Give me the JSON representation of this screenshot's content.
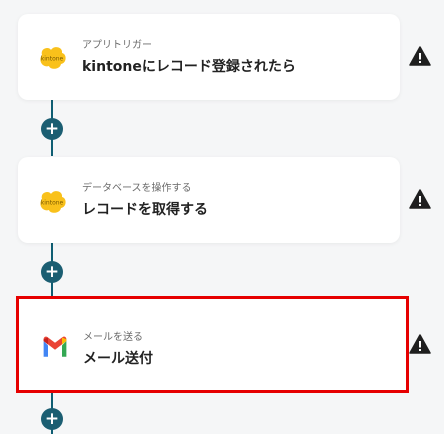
{
  "steps": [
    {
      "subtitle": "アプリトリガー",
      "title": "kintoneにレコード登録されたら",
      "app": "kintone",
      "icon": "kintone-icon"
    },
    {
      "subtitle": "データベースを操作する",
      "title": "レコードを取得する",
      "app": "kintone",
      "icon": "kintone-icon"
    },
    {
      "subtitle": "メールを送る",
      "title": "メール送付",
      "app": "Gmail",
      "icon": "gmail-icon",
      "selected": true
    }
  ],
  "add_button_label": "+",
  "icons": {
    "warning": "warning-icon",
    "add": "plus-icon"
  },
  "colors": {
    "connector": "#0f5e73",
    "add_button": "#1b5e72",
    "selection": "#e60000",
    "warning": "#1f1f1f",
    "kintone": "#f9c11b"
  }
}
